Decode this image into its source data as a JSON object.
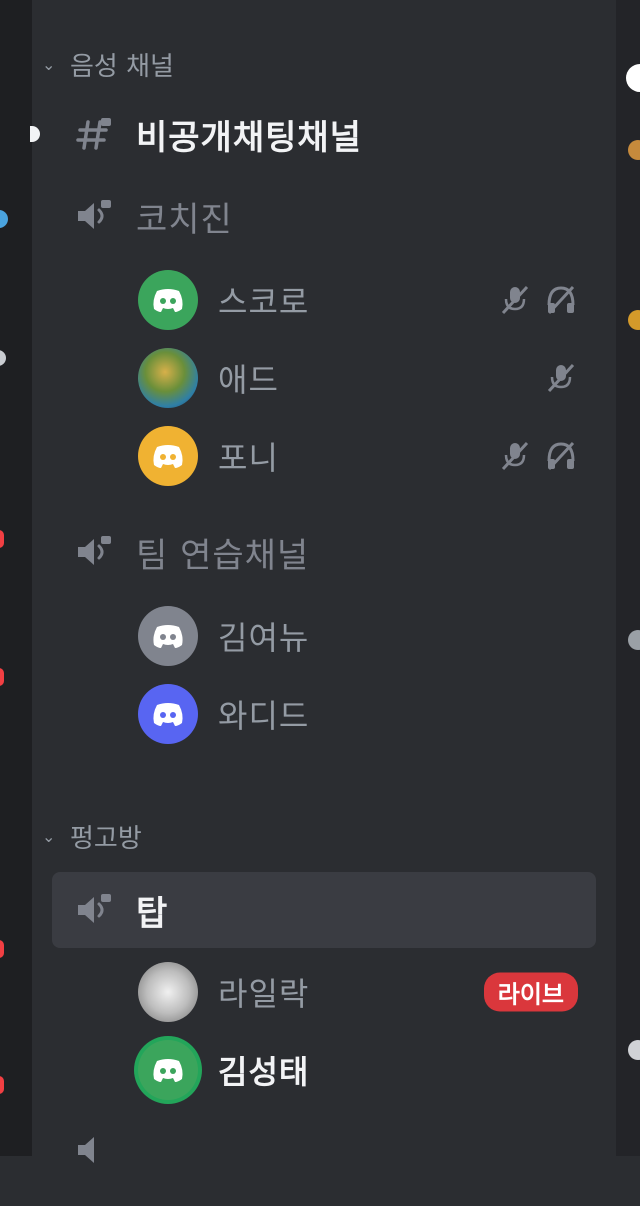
{
  "categories": {
    "voice": "음성 채널",
    "pyeonggobang": "펑고방"
  },
  "channels": {
    "private_chat": "비공개채팅채널",
    "coach": "코치진",
    "team_practice": "팀 연습채널",
    "top": "탑"
  },
  "users": {
    "u1": "스코로",
    "u2": "애드",
    "u3": "포니",
    "u4": "김여뉴",
    "u5": "와디드",
    "u6": "라일락",
    "u7": "김성태"
  },
  "badges": {
    "live": "라이브"
  },
  "colors": {
    "bg": "#2b2d31",
    "green": "#23a55a",
    "yellow": "#f0b232",
    "gray": "#80848e",
    "blurple": "#5865f2",
    "live": "#da373c"
  }
}
